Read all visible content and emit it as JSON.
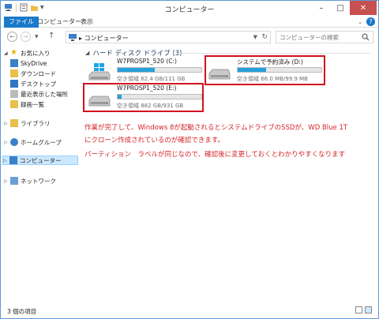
{
  "window": {
    "title": "コンピューター"
  },
  "ribbon": {
    "tabs": [
      "ファイル",
      "コンピューター",
      "表示"
    ]
  },
  "address": {
    "path": "コンピューター",
    "search_placeholder": "コンピューターの検索"
  },
  "sidebar": {
    "favorites": "お気に入り",
    "favorite_items": [
      "SkyDrive",
      "ダウンロード",
      "デスクトップ",
      "最近表示した場所",
      "録画一覧"
    ],
    "libraries": "ライブラリ",
    "homegroup": "ホームグループ",
    "computer": "コンピューター",
    "network": "ネットワーク"
  },
  "content": {
    "group_title": "ハード ディスク ドライブ (3)",
    "drives": [
      {
        "name": "W7PROSP1_520 (C:)",
        "free_text": "空き領域 62.4 GB/111 GB",
        "used_fraction": 0.44
      },
      {
        "name": "システムで予約済み (D:)",
        "free_text": "空き領域 66.0 MB/99.9 MB",
        "used_fraction": 0.34
      },
      {
        "name": "W7PROSP1_520 (E:)",
        "free_text": "空き領域 882 GB/931 GB",
        "used_fraction": 0.05
      }
    ],
    "notes": [
      "作業が完了して、Windows 8が起動されるとシステムドライブのSSDが、WD Blue 1T",
      "にクローン作成されているのが確認できます。",
      "パーティション　ラベルが同じなので、確認後に変更しておくとわかりやすくなります"
    ]
  },
  "status": {
    "items_text": "3 個の項目"
  },
  "colors": {
    "accent": "#1979ca",
    "highlight": "#d0121f",
    "note_text": "#d4242a",
    "bar_fill": "#26a0da"
  }
}
